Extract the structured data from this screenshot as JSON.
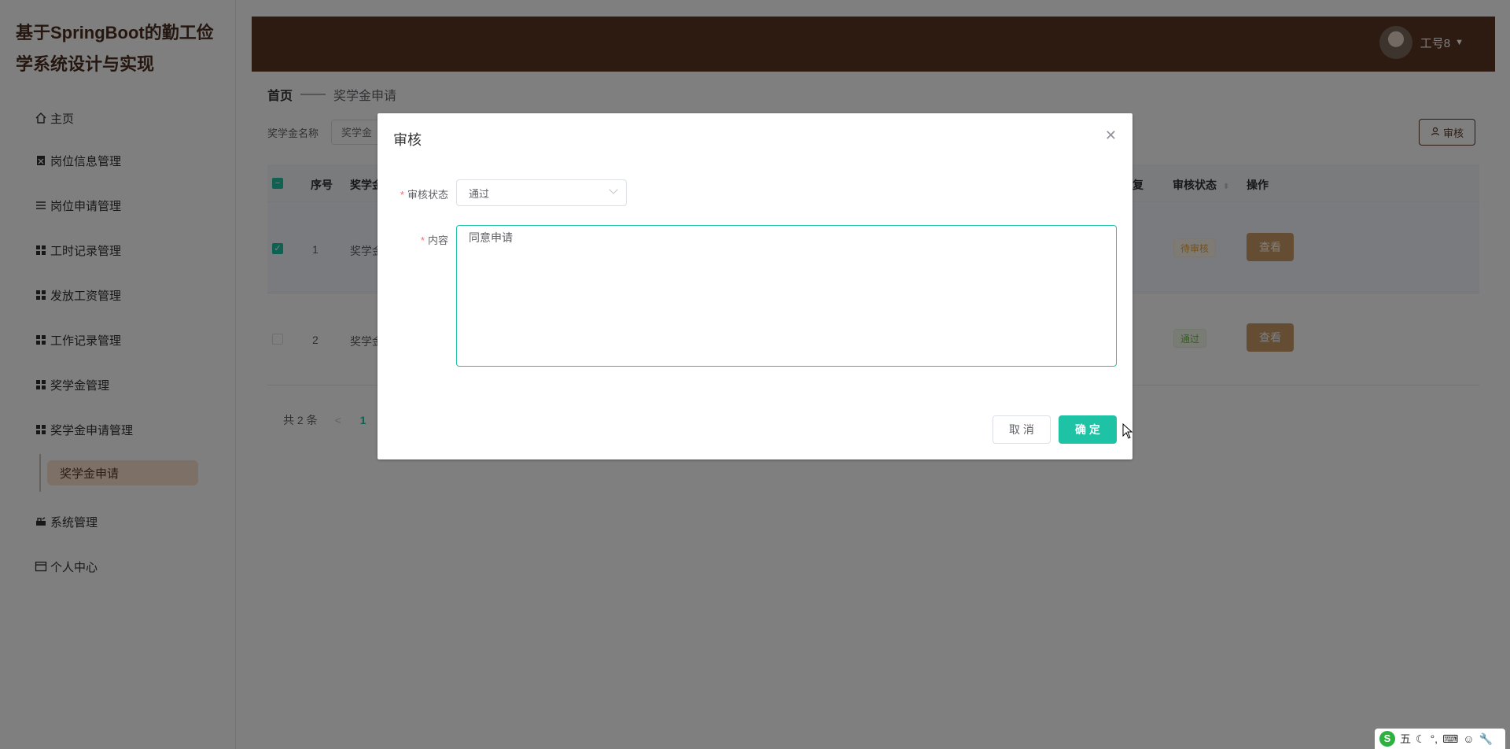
{
  "app": {
    "title": "基于SpringBoot的勤工俭学系统设计与实现"
  },
  "sidebar": {
    "items": [
      {
        "label": "主页",
        "icon": "home-icon"
      },
      {
        "label": "岗位信息管理",
        "icon": "clipboard-icon"
      },
      {
        "label": "岗位申请管理",
        "icon": "list-icon"
      },
      {
        "label": "工时记录管理",
        "icon": "grid-icon"
      },
      {
        "label": "发放工资管理",
        "icon": "grid-icon"
      },
      {
        "label": "工作记录管理",
        "icon": "grid-icon"
      },
      {
        "label": "奖学金管理",
        "icon": "grid-icon"
      },
      {
        "label": "奖学金申请管理",
        "icon": "grid-icon"
      },
      {
        "label": "系统管理",
        "icon": "settings-icon"
      },
      {
        "label": "个人中心",
        "icon": "window-icon"
      }
    ],
    "sub_item": "奖学金申请"
  },
  "header": {
    "user_label": "工号8"
  },
  "breadcrumb": {
    "home": "首页",
    "separator": "——",
    "current": "奖学金申请"
  },
  "search": {
    "label": "奖学金名称",
    "placeholder": "奖学金"
  },
  "toolbar": {
    "audit_label": "审核"
  },
  "table": {
    "columns": [
      "序号",
      "奖学金",
      "复",
      "审核状态",
      "操作"
    ],
    "rows": [
      {
        "index": "1",
        "name": "奖学金",
        "status": "待审核",
        "action": "查看",
        "checked": true
      },
      {
        "index": "2",
        "name": "奖学金",
        "status": "通过",
        "action": "查看",
        "checked": false
      }
    ]
  },
  "pagination": {
    "total": "共 2 条",
    "prev": "<",
    "page": "1"
  },
  "dialog": {
    "title": "审核",
    "status_label": "审核状态",
    "status_value": "通过",
    "content_label": "内容",
    "content_value": "同意申请",
    "cancel_label": "取 消",
    "confirm_label": "确 定"
  },
  "ime": {
    "mode": "五"
  },
  "colors": {
    "brand": "#5a3523",
    "accent": "#1ec2a5",
    "highlight": "#fbe0cf",
    "overlay": "rgba(0,0,0,0.5)"
  }
}
